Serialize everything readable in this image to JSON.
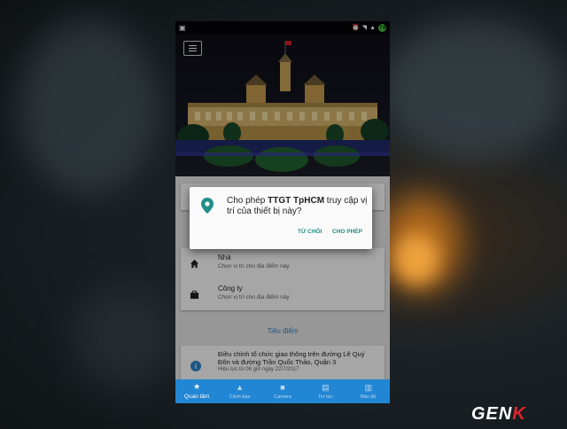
{
  "status_bar": {
    "icons": [
      "image-icon",
      "alarm-icon",
      "wifi-icon",
      "signal-icon",
      "battery-icon"
    ],
    "battery_label": "74"
  },
  "app": {
    "menu_icon": "hamburger-menu-icon",
    "hero_image": "ho-chi-minh-city-hall-at-night"
  },
  "places": [
    {
      "title": "Nhà",
      "subtitle": "Chọn vị trí cho địa điểm này",
      "icon": "home-icon"
    },
    {
      "title": "Công ty",
      "subtitle": "Chọn vị trí cho địa điểm này",
      "icon": "briefcase-icon"
    }
  ],
  "focus": {
    "title": "Tiêu điểm"
  },
  "news": {
    "title": "Điều chỉnh tổ chức giao thông trên đường Lê Quý Đôn và đường Trần Quốc Thảo, Quận 3",
    "subtitle": "Hiệu lực từ 08 giờ ngày 22/7/2017",
    "icon": "info-icon"
  },
  "dialog": {
    "prefix": "Cho phép ",
    "app_name": "TTGT TpHCM",
    "suffix": " truy cập vị trí của thiết bị này?",
    "deny_label": "TỪ CHỐI",
    "allow_label": "CHO PHÉP",
    "icon": "location-pin-icon",
    "accent_color": "#1f8f88"
  },
  "bottom_nav": [
    {
      "label": "Quan tâm",
      "icon": "star-icon",
      "glyph": "★",
      "active": true
    },
    {
      "label": "Cảnh báo",
      "icon": "warning-icon",
      "glyph": "▲",
      "active": false
    },
    {
      "label": "Camera",
      "icon": "camera-icon",
      "glyph": "■",
      "active": false
    },
    {
      "label": "Tin tức",
      "icon": "news-icon",
      "glyph": "▤",
      "active": false
    },
    {
      "label": "Bản đồ",
      "icon": "map-icon",
      "glyph": "▥",
      "active": false
    }
  ],
  "colors": {
    "nav_bar": "#2186d4",
    "link": "#2f86c9"
  },
  "watermark": {
    "text_main": "GEN",
    "text_accent": "K"
  }
}
